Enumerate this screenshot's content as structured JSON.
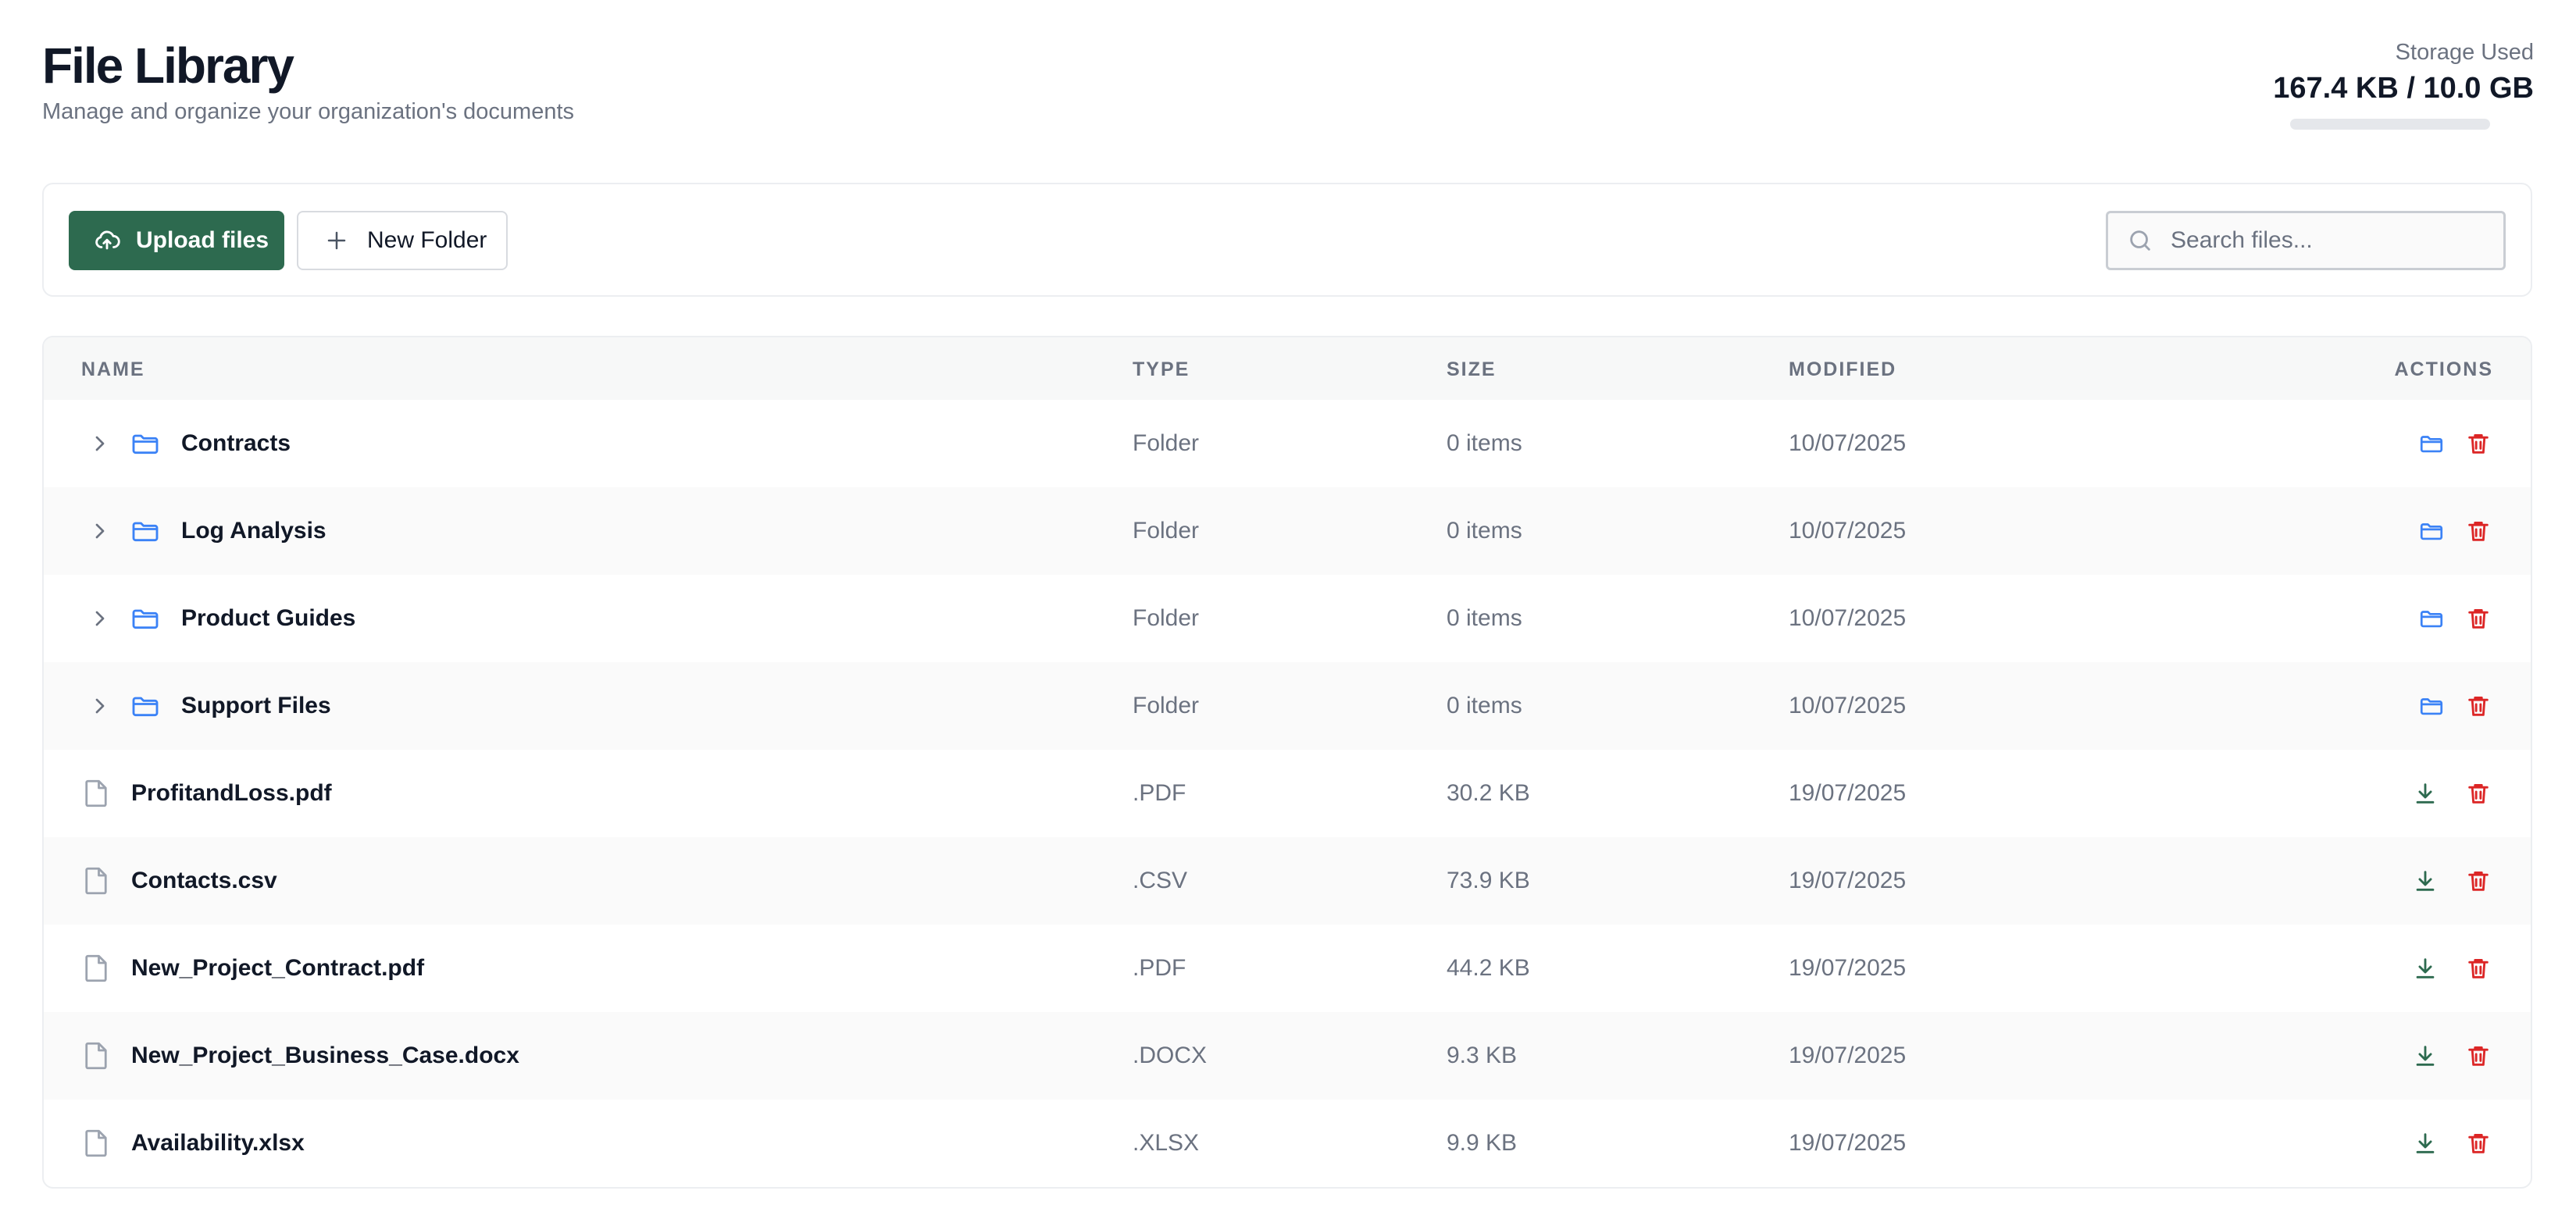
{
  "header": {
    "title": "File Library",
    "subtitle": "Manage and organize your organization's documents",
    "storage_label": "Storage Used",
    "storage_value": "167.4 KB / 10.0 GB",
    "storage_fraction": 0.0
  },
  "toolbar": {
    "upload_label": "Upload files",
    "new_folder_label": "New Folder",
    "search_placeholder": "Search files...",
    "search_value": ""
  },
  "table": {
    "columns": [
      "NAME",
      "TYPE",
      "SIZE",
      "MODIFIED",
      "ACTIONS"
    ],
    "rows": [
      {
        "kind": "folder",
        "name": "Contracts",
        "type": "Folder",
        "size": "0 items",
        "modified": "10/07/2025"
      },
      {
        "kind": "folder",
        "name": "Log Analysis",
        "type": "Folder",
        "size": "0 items",
        "modified": "10/07/2025"
      },
      {
        "kind": "folder",
        "name": "Product Guides",
        "type": "Folder",
        "size": "0 items",
        "modified": "10/07/2025"
      },
      {
        "kind": "folder",
        "name": "Support Files",
        "type": "Folder",
        "size": "0 items",
        "modified": "10/07/2025"
      },
      {
        "kind": "file",
        "name": "ProfitandLoss.pdf",
        "type": ".PDF",
        "size": "30.2 KB",
        "modified": "19/07/2025"
      },
      {
        "kind": "file",
        "name": "Contacts.csv",
        "type": ".CSV",
        "size": "73.9 KB",
        "modified": "19/07/2025"
      },
      {
        "kind": "file",
        "name": "New_Project_Contract.pdf",
        "type": ".PDF",
        "size": "44.2 KB",
        "modified": "19/07/2025"
      },
      {
        "kind": "file",
        "name": "New_Project_Business_Case.docx",
        "type": ".DOCX",
        "size": "9.3 KB",
        "modified": "19/07/2025"
      },
      {
        "kind": "file",
        "name": "Availability.xlsx",
        "type": ".XLSX",
        "size": "9.9 KB",
        "modified": "19/07/2025"
      }
    ]
  },
  "colors": {
    "primary": "#2d6a4f",
    "folder_icon": "#3b82f6",
    "delete_icon": "#dc2626",
    "download_icon": "#2d6a4f",
    "file_icon": "#9ca3af"
  },
  "icons": {
    "upload": "cloud-upload-icon",
    "new_folder": "plus-icon",
    "search": "search-icon",
    "expand": "chevron-right-icon",
    "folder": "folder-icon",
    "file": "file-icon",
    "open_folder": "folder-open-icon",
    "download": "download-icon",
    "delete": "trash-icon"
  }
}
